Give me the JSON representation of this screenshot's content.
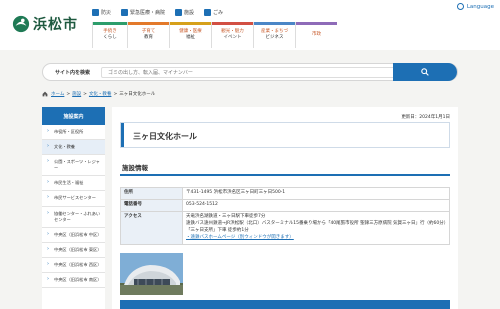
{
  "site": {
    "name": "浜松市"
  },
  "topbar": {
    "items": [
      {
        "label": "防災"
      },
      {
        "label": "緊急医療・病院"
      },
      {
        "label": "施設"
      },
      {
        "label": "ごみ"
      }
    ],
    "language": "Language"
  },
  "nav": [
    {
      "line1": "手続き",
      "line2": "くらし"
    },
    {
      "line1": "子育て",
      "line2": "教育"
    },
    {
      "line1": "健康・医療",
      "line2": "福祉"
    },
    {
      "line1": "観光・魅力",
      "line2": "イベント"
    },
    {
      "line1": "産業・まちづ",
      "line2": "ビジネス"
    },
    {
      "line1": "市政",
      "line2": ""
    }
  ],
  "search": {
    "label": "サイト内を検索",
    "placeholder": "ゴミの出し方、転入届、マイナンバー"
  },
  "breadcrumb": {
    "items": [
      "ホーム",
      "施設",
      "文化・教養"
    ],
    "current": "三ヶ日文化ホール"
  },
  "sidebar": {
    "title": "施設案内",
    "items": [
      "市役所・区役所",
      "文化・教養",
      "公園・スポーツ・レジャー",
      "市民生活・福祉",
      "市民サービスセンター",
      "協働センター・ふれあいセンター",
      "中央区（旧浜松市 中区）",
      "中央区（旧浜松市 東区）",
      "中央区（旧浜松市 西区）",
      "中央区（旧浜松市 南区）"
    ],
    "active_index": 1
  },
  "page": {
    "updated": "更新日：2024年1月1日",
    "title": "三ヶ日文化ホール",
    "section_title": "施設情報",
    "info_rows": [
      {
        "key": "住所",
        "value": "〒431-1495 浜松市浜名区三ヶ日町三ヶ日500-1"
      },
      {
        "key": "電話番号",
        "value": "053-524-1512"
      },
      {
        "key": "アクセス",
        "value": "天竜浜名湖鉄道・三ヶ日駅下車徒歩7分",
        "value2": "遠鉄バス遠州鉄道→JR浜松駅（北口）バスターミナル15番乗り場から「40尾張市役所 聖隷三方原病院 気賀三ヶ日」行（約60分）「三ヶ日支所」下車 徒歩約1分",
        "link": "・遠鉄バスホームページ（別ウィンドウが開きます）"
      }
    ]
  },
  "colors": {
    "accent": "#1d6fb4",
    "logo_green": "#1f5a40"
  }
}
